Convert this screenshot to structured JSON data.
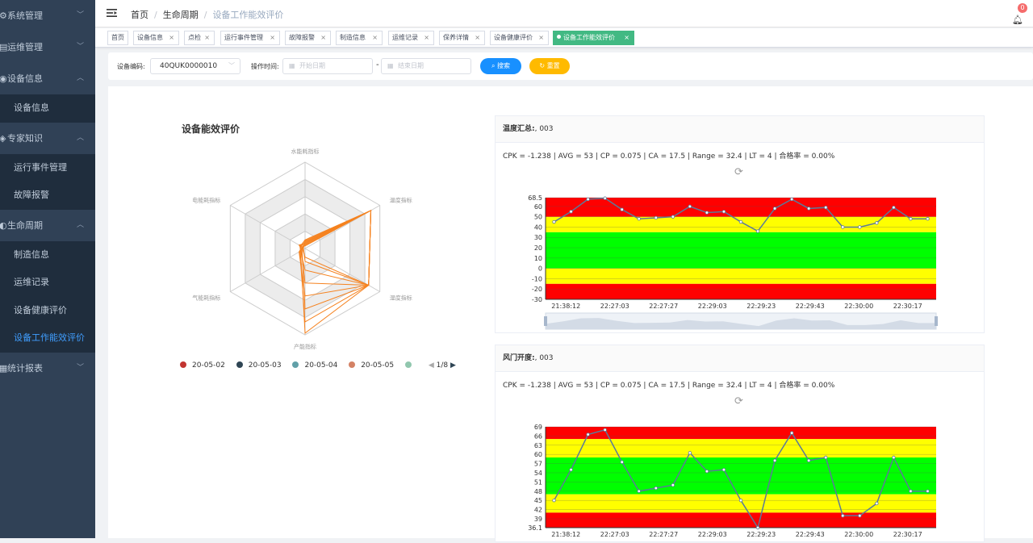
{
  "sidebar": {
    "items": [
      {
        "label": "系统管理",
        "arrow": "down"
      },
      {
        "label": "运维管理",
        "arrow": "down"
      },
      {
        "label": "设备信息",
        "arrow": "up",
        "children": [
          {
            "label": "设备信息"
          }
        ]
      },
      {
        "label": "专家知识",
        "arrow": "up",
        "children": [
          {
            "label": "运行事件管理"
          },
          {
            "label": "故障报警"
          }
        ]
      },
      {
        "label": "生命周期",
        "arrow": "up",
        "children": [
          {
            "label": "制造信息"
          },
          {
            "label": "运维记录"
          },
          {
            "label": "设备健康评价"
          },
          {
            "label": "设备工作能效评价",
            "active": true
          }
        ]
      },
      {
        "label": "统计报表",
        "arrow": "down"
      }
    ]
  },
  "header": {
    "breadcrumb": [
      "首页",
      "生命周期",
      "设备工作能效评价"
    ],
    "notification_count": "0"
  },
  "tags": [
    {
      "label": "首页"
    },
    {
      "label": "设备信息"
    },
    {
      "label": "点检"
    },
    {
      "label": "运行事件管理"
    },
    {
      "label": "故障报警"
    },
    {
      "label": "制造信息"
    },
    {
      "label": "运维记录"
    },
    {
      "label": "保养详情"
    },
    {
      "label": "设备健康评价"
    },
    {
      "label": "设备工作能效评价",
      "active": true
    }
  ],
  "filters": {
    "code_label": "设备编码:",
    "code_value": "40QUK0000010",
    "time_label": "操作时间:",
    "start_placeholder": "开始日期",
    "end_placeholder": "结束日期",
    "dash": "-",
    "search_label": "搜索",
    "reset_label": "重置"
  },
  "colors": {
    "sidebar_bg": "#304156",
    "accent": "#409eff",
    "active_tag": "#42b983",
    "radar_line": "#f5821f",
    "band_red": "#ff0000",
    "band_yellow": "#ffff00",
    "band_green": "#00ff00",
    "series_line": "#5b7a99"
  },
  "icons": {
    "hamburger": "hamburger-icon",
    "bell": "bell-icon",
    "refresh": "refresh-icon",
    "calendar": "calendar-icon",
    "search": "search-icon"
  },
  "radar": {
    "title": "设备能效评价",
    "indicators": [
      "水能耗指标",
      "温度指标",
      "湿度指标",
      "产能指标",
      "气能耗指标",
      "电能耗指标"
    ],
    "legend": [
      {
        "name": "20-05-02",
        "color": "#c23531"
      },
      {
        "name": "20-05-03",
        "color": "#2f4554"
      },
      {
        "name": "20-05-04",
        "color": "#61a0a8"
      },
      {
        "name": "20-05-05",
        "color": "#d48265"
      },
      {
        "name": "",
        "color": "#91c7ae"
      }
    ],
    "page": "1/8"
  },
  "chart_data": [
    {
      "type": "radar",
      "title": "设备能效评价",
      "indicators": [
        "水能耗指标",
        "温度指标",
        "湿度指标",
        "产能指标",
        "气能耗指标",
        "电能耗指标"
      ],
      "max": 100,
      "series": [
        {
          "name": "20-05-02",
          "values": [
            8,
            88,
            85,
            10,
            3,
            5
          ]
        },
        {
          "name": "20-05-03",
          "values": [
            5,
            88,
            85,
            25,
            6,
            3
          ]
        },
        {
          "name": "20-05-04",
          "values": [
            10,
            88,
            85,
            40,
            5,
            6
          ]
        },
        {
          "name": "20-05-05",
          "values": [
            3,
            88,
            85,
            55,
            8,
            4
          ]
        },
        {
          "values": [
            6,
            88,
            85,
            70,
            4,
            8
          ]
        },
        {
          "values": [
            9,
            88,
            85,
            85,
            7,
            2
          ]
        },
        {
          "values": [
            4,
            88,
            85,
            98,
            6,
            7
          ]
        },
        {
          "values": [
            7,
            88,
            85,
            15,
            2,
            3
          ]
        }
      ]
    },
    {
      "type": "line",
      "title": "温度汇总:",
      "title_suffix": ", 003",
      "stats": "CPK = -1.238 | AVG = 53 | CP = 0.075 | CA = 17.5 | Range = 32.4 | LT = 4 | 合格率 = 0.00%",
      "ylim": [
        -30,
        68.5
      ],
      "yticks": [
        "68.5",
        "60",
        "50",
        "40",
        "30",
        "20",
        "10",
        "0",
        "-10",
        "-20",
        "-30"
      ],
      "xticks": [
        "21:38:12",
        "22:27:03",
        "22:27:27",
        "22:29:03",
        "22:29:23",
        "22:29:43",
        "22:30:00",
        "22:30:17"
      ],
      "bands": [
        {
          "from": 50,
          "to": 68.5,
          "color": "#ff0000"
        },
        {
          "from": 35,
          "to": 50,
          "color": "#ffff00"
        },
        {
          "from": 0,
          "to": 35,
          "color": "#00ff00"
        },
        {
          "from": -15,
          "to": 0,
          "color": "#ffff00"
        },
        {
          "from": -30,
          "to": -15,
          "color": "#ff0000"
        }
      ],
      "series": [
        {
          "values": [
            45,
            55,
            67,
            68,
            57,
            48,
            49,
            50,
            60,
            54,
            55,
            45,
            36,
            58,
            67,
            58,
            59,
            40,
            40,
            44,
            59,
            48,
            48
          ]
        }
      ]
    },
    {
      "type": "line",
      "title": "风门开度:",
      "title_suffix": ", 003",
      "stats": "CPK = -1.238 | AVG = 53 | CP = 0.075 | CA = 17.5 | Range = 32.4 | LT = 4 | 合格率 = 0.00%",
      "ylim": [
        36.1,
        69
      ],
      "yticks": [
        "69",
        "66",
        "63",
        "60",
        "57",
        "54",
        "51",
        "48",
        "45",
        "42",
        "39",
        "36.1"
      ],
      "xticks": [
        "21:38:12",
        "22:27:03",
        "22:27:27",
        "22:29:03",
        "22:29:23",
        "22:29:43",
        "22:30:00",
        "22:30:17"
      ],
      "bands": [
        {
          "from": 65,
          "to": 69,
          "color": "#ff0000"
        },
        {
          "from": 59,
          "to": 65,
          "color": "#ffff00"
        },
        {
          "from": 47,
          "to": 59,
          "color": "#00ff00"
        },
        {
          "from": 41,
          "to": 47,
          "color": "#ffff00"
        },
        {
          "from": 36.1,
          "to": 41,
          "color": "#ff0000"
        }
      ],
      "series": [
        {
          "values": [
            45,
            55,
            66.5,
            68,
            57.5,
            48,
            49,
            50,
            60.5,
            54.5,
            55,
            45,
            36.1,
            58,
            67,
            58,
            59,
            40,
            40,
            44,
            59,
            48,
            48
          ]
        }
      ]
    }
  ]
}
